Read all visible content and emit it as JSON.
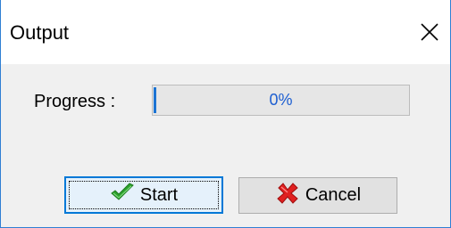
{
  "window": {
    "title": "Output",
    "close_icon": "close-icon"
  },
  "progress": {
    "label": "Progress :",
    "text": "0%",
    "value": 0
  },
  "buttons": {
    "start_label": "Start",
    "start_icon": "checkmark-icon",
    "cancel_label": "Cancel",
    "cancel_icon": "red-x-icon"
  },
  "colors": {
    "accent": "#0078d7",
    "progress_text": "#1c5ed1",
    "window_border": "#2f7fd3"
  }
}
